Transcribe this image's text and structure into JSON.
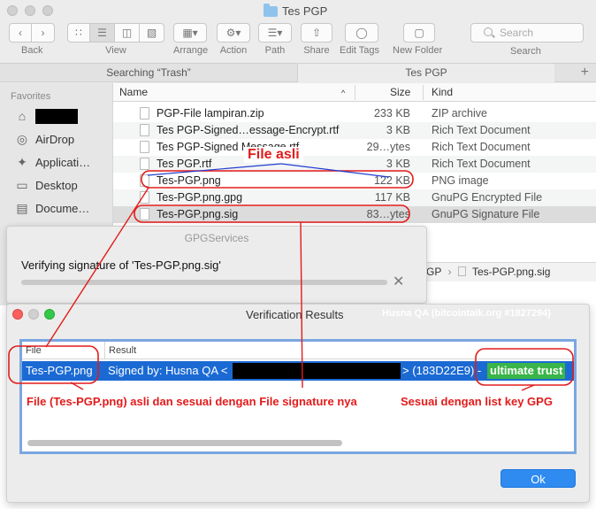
{
  "finder": {
    "title": "Tes PGP",
    "toolbar": {
      "back_label": "Back",
      "view_label": "View",
      "arrange_label": "Arrange",
      "action_label": "Action",
      "path_label": "Path",
      "share_label": "Share",
      "edit_tags_label": "Edit Tags",
      "new_folder_label": "New Folder",
      "search_placeholder": "Search",
      "search_label": "Search"
    },
    "tabs": [
      {
        "label": "Searching “Trash”"
      },
      {
        "label": "Tes PGP"
      }
    ],
    "sidebar": {
      "heading": "Favorites",
      "items": [
        {
          "label": "",
          "icon": "home-icon"
        },
        {
          "label": "AirDrop",
          "icon": "airdrop-icon"
        },
        {
          "label": "Applicati…",
          "icon": "applications-icon"
        },
        {
          "label": "Desktop",
          "icon": "desktop-icon"
        },
        {
          "label": "Docume…",
          "icon": "documents-icon"
        }
      ]
    },
    "columns": {
      "name": "Name",
      "size": "Size",
      "kind": "Kind"
    },
    "files": [
      {
        "name": "PGP-File lampiran.zip",
        "size": "233 KB",
        "kind": "ZIP archive"
      },
      {
        "name": "Tes PGP-Signed…essage-Encrypt.rtf",
        "size": "3 KB",
        "kind": "Rich Text Document"
      },
      {
        "name": "Tes PGP-Signed Message.rtf",
        "size": "29…ytes",
        "kind": "Rich Text Document"
      },
      {
        "name": "Tes PGP.rtf",
        "size": "3 KB",
        "kind": "Rich Text Document"
      },
      {
        "name": "Tes-PGP.png",
        "size": "122 KB",
        "kind": "PNG image"
      },
      {
        "name": "Tes-PGP.png.gpg",
        "size": "117 KB",
        "kind": "GnuPG Encrypted File"
      },
      {
        "name": "Tes-PGP.png.sig",
        "size": "83…ytes",
        "kind": "GnuPG Signature File"
      }
    ],
    "pathbar": {
      "prefix": "GP",
      "sep": "›",
      "file": "Tes-PGP.png.sig"
    }
  },
  "gpg_panel": {
    "title": "GPGServices",
    "message": "Verifying signature of 'Tes-PGP.png.sig'",
    "cancel_glyph": "✕"
  },
  "verification": {
    "title": "Verification Results",
    "watermark": "Husna QA (bitcointalk.org #1827294)",
    "col_file": "File",
    "col_result": "Result",
    "row_file": "Tes-PGP.png",
    "row_result_prefix": "Signed by: Husna QA <",
    "row_result_suffix": "> (183D22E9) -",
    "trust": "ultimate trust",
    "ok_label": "Ok"
  },
  "annotations": {
    "file_asli": "File asli",
    "note_left": "File (Tes-PGP.png) asli dan sesuai dengan File signature nya",
    "note_right": "Sesuai dengan list key GPG"
  },
  "colors": {
    "annotation": "#e31b1b",
    "selection": "#1b6ad4",
    "trust": "#39b54a",
    "ok_button": "#2f8bf0"
  }
}
